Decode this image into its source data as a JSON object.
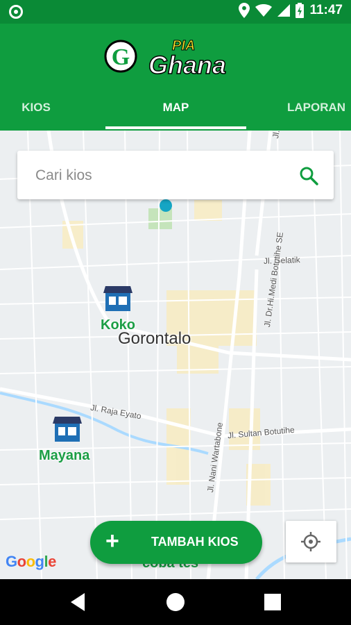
{
  "status_bar": {
    "time": "11:47",
    "icons": [
      "location-icon",
      "wifi-icon",
      "signal-icon",
      "battery-charging-icon"
    ]
  },
  "app": {
    "logo_letter": "G",
    "logo_text": "Ghana",
    "logo_superscript": "PIA",
    "brand_color": "#0f9d3f"
  },
  "tabs": [
    {
      "label": "KIOS",
      "selected": false
    },
    {
      "label": "MAP",
      "selected": true
    },
    {
      "label": "LAPORAN",
      "selected": false
    }
  ],
  "search": {
    "placeholder": "Cari kios"
  },
  "map": {
    "city_label": "Gorontalo",
    "streets": [
      "Jl. Gelatik",
      "Jl. Dr.Hi.Medi Botutihe SE",
      "Jl. Raja Eyato",
      "Jl. Sultan Botutihe",
      "Jl. Nani Wartabone",
      "Jl. Dr.Hi.Medi Botutihe SE"
    ],
    "markers": [
      {
        "name": "Koko",
        "icon": "store-icon"
      },
      {
        "name": "Mayana",
        "icon": "store-icon"
      },
      {
        "name": "coba tes",
        "icon": "store-icon"
      }
    ],
    "attribution": "Google"
  },
  "fab": {
    "icon": "plus-icon",
    "label": "TAMBAH KIOS"
  },
  "my_location_button": {
    "icon": "crosshair-icon"
  },
  "nav_bar": {
    "buttons": [
      "back-icon",
      "home-icon",
      "recents-icon"
    ]
  }
}
